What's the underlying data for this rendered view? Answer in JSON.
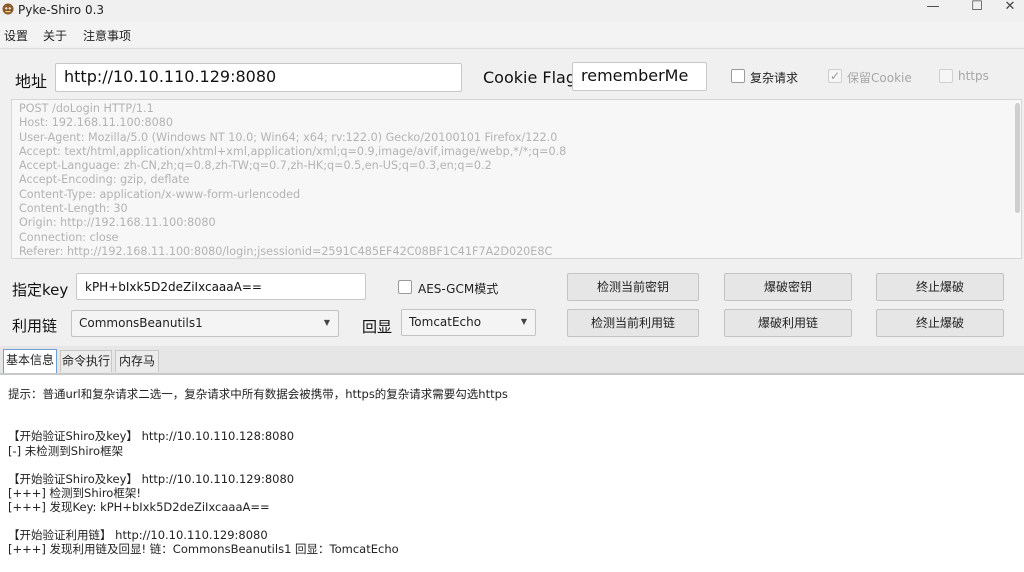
{
  "window": {
    "title": "Pyke-Shiro 0.3",
    "minimize_glyph": "—",
    "maximize_glyph": "☐",
    "close_glyph": "✕"
  },
  "menu": [
    "设置",
    "关于",
    "注意事项"
  ],
  "form": {
    "address_label": "地址",
    "address_value": "http://10.10.110.129:8080",
    "cookie_flag_label": "Cookie Flag",
    "cookie_flag_value": "rememberMe",
    "complex_request_label": "复杂请求",
    "keep_cookie_label": "保留Cookie",
    "https_label": "https"
  },
  "request_lines": [
    "POST /doLogin HTTP/1.1",
    "Host: 192.168.11.100:8080",
    "User-Agent: Mozilla/5.0 (Windows NT 10.0; Win64; x64; rv:122.0) Gecko/20100101 Firefox/122.0",
    "Accept: text/html,application/xhtml+xml,application/xml;q=0.9,image/avif,image/webp,*/*;q=0.8",
    "Accept-Language: zh-CN,zh;q=0.8,zh-TW;q=0.7,zh-HK;q=0.5,en-US;q=0.3,en;q=0.2",
    "Accept-Encoding: gzip, deflate",
    "Content-Type: application/x-www-form-urlencoded",
    "Content-Length: 30",
    "Origin: http://192.168.11.100:8080",
    "Connection: close",
    "Referer: http://192.168.11.100:8080/login;jsessionid=2591C485EF42C08BF1C41F7A2D020E8C"
  ],
  "key_row": {
    "label": "指定key",
    "key_value": "kPH+bIxk5D2deZiIxcaaaA==",
    "aes_gcm_label": "AES-GCM模式",
    "detect_key_button": "检测当前密钥",
    "brute_key_button": "爆破密钥",
    "stop_button": "终止爆破"
  },
  "chain_row": {
    "label": "利用链",
    "chain_value": "CommonsBeanutils1",
    "echo_label": "回显",
    "echo_value": "TomcatEcho",
    "detect_chain_button": "检测当前利用链",
    "brute_chain_button": "爆破利用链",
    "stop_button": "终止爆破"
  },
  "tabs": [
    "基本信息",
    "命令执行",
    "内存马"
  ],
  "output_lines": [
    "提示：普通url和复杂请求二选一，复杂请求中所有数据会被携带，https的复杂请求需要勾选https",
    "【开始验证Shiro及key】 http://10.10.110.128:8080",
    "[-]  未检测到Shiro框架",
    "【开始验证Shiro及key】 http://10.10.110.129:8080",
    "[+++]  检测到Shiro框架!",
    "[+++]  发现Key:  kPH+bIxk5D2deZiIxcaaaA==",
    "【开始验证利用链】 http://10.10.110.129:8080",
    "[+++]  发现利用链及回显!  链：CommonsBeanutils1  回显：TomcatEcho"
  ]
}
